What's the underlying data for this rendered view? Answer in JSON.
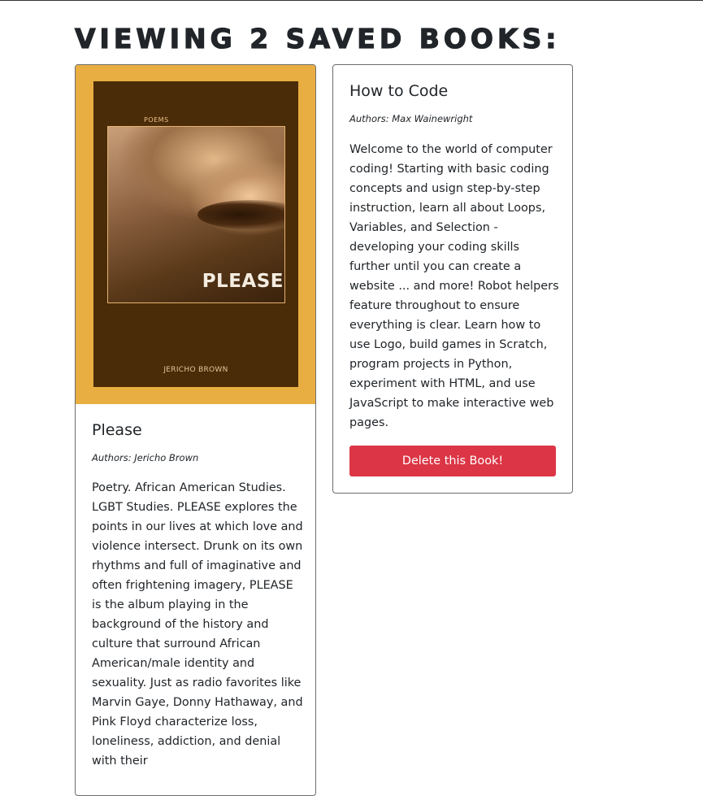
{
  "header": {
    "title": "Viewing 2 saved books:"
  },
  "books": [
    {
      "title": "Please",
      "authors": "Authors: Jericho Brown",
      "description": "Poetry. African American Studies. LGBT Studies. PLEASE explores the points in our lives at which love and violence intersect. Drunk on its own rhythms and full of imaginative and often frightening imagery, PLEASE is the album playing in the background of the history and culture that surround African American/male identity and sexuality. Just as radio favorites like Marvin Gaye, Donny Hathaway, and Pink Floyd characterize loss, loneliness, addiction, and denial with their",
      "cover": {
        "series_label": "POEMS",
        "title_text": "PLEASE",
        "author_text": "JERICHO BROWN",
        "background_color": "#e8ae41",
        "inner_color": "#4a2c08"
      }
    },
    {
      "title": "How to Code",
      "authors": "Authors: Max Wainewright",
      "description": "Welcome to the world of computer coding! Starting with basic coding concepts and usign step-by-step instruction, learn all about Loops, Variables, and Selection - developing your coding skills further until you can create a website ... and more! Robot helpers feature throughout to ensure everything is clear. Learn how to use Logo, build games in Scratch, program projects in Python, experiment with HTML, and use JavaScript to make interactive web pages.",
      "delete_label": "Delete this Book!"
    }
  ],
  "colors": {
    "danger": "#dc3545",
    "text": "#212529",
    "card_border": "#6c6c6c"
  }
}
